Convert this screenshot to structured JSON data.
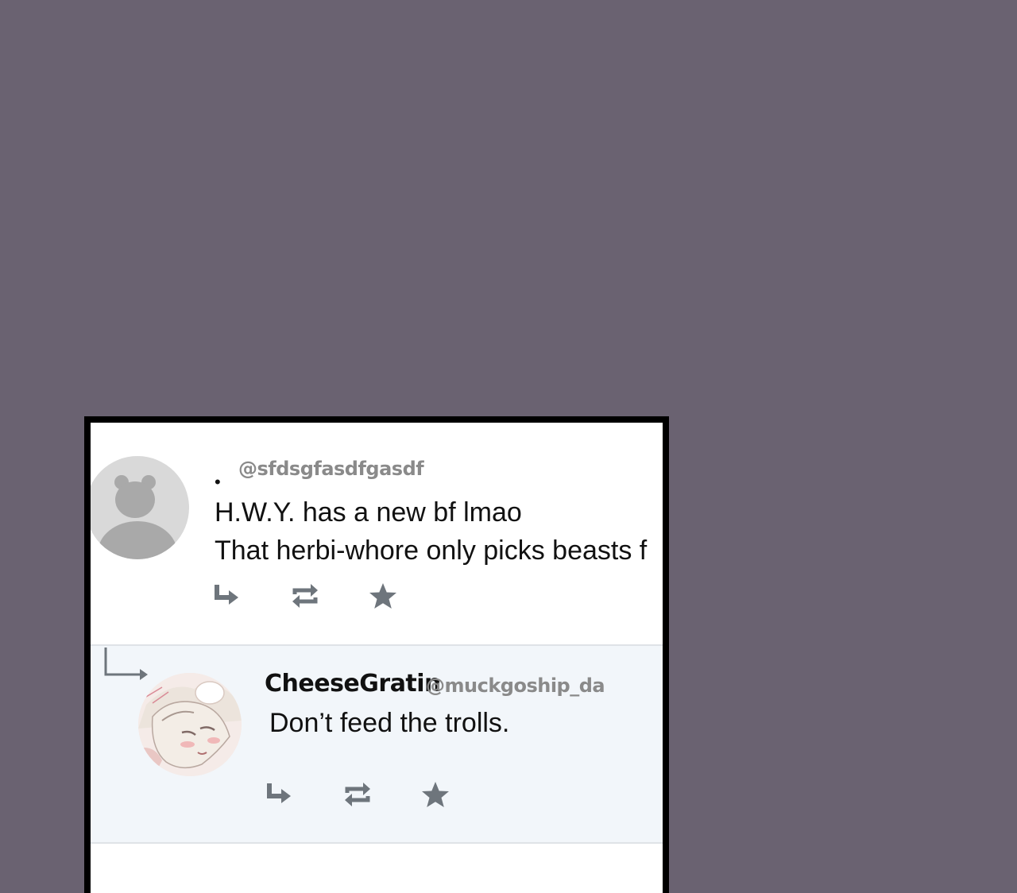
{
  "colors": {
    "background": "#6a6271",
    "frame": "#000000",
    "icon_gray": "#6e757c",
    "handle_gray": "#8a8a8a",
    "reply_bg": "#f2f6fa"
  },
  "tweet": {
    "display_name": "",
    "bullet": "•",
    "handle": "@sfdsgfasdfgasdf",
    "lines": [
      "H.W.Y. has a new bf lmao",
      "That herbi-whore only picks beasts f"
    ],
    "avatar": "default-avatar-icon",
    "actions": [
      "reply-icon",
      "retweet-icon",
      "favorite-icon"
    ]
  },
  "reply": {
    "display_name": "CheeseGratin",
    "handle": "@muckgoship_da",
    "text": "Don’t feed the trolls.",
    "avatar": "anime-character-avatar",
    "actions": [
      "reply-icon",
      "retweet-icon",
      "favorite-icon"
    ]
  }
}
